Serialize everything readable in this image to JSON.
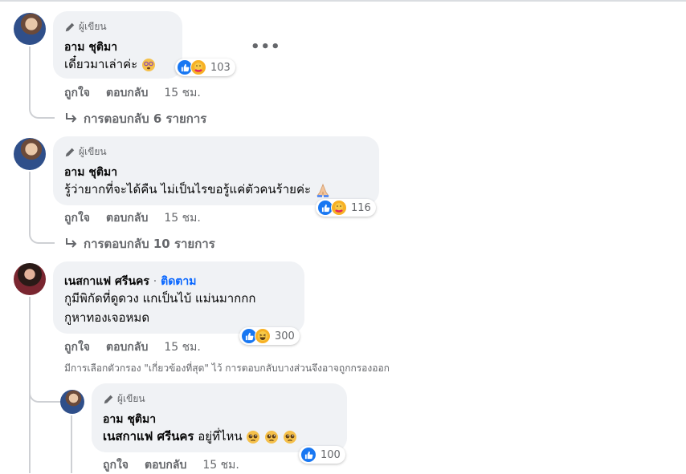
{
  "comments": [
    {
      "author_badge": "ผู้เขียน",
      "name": "อาม ชุติมา",
      "text": "เดี๋ยวมาเล่าค่ะ",
      "reaction_count": "103",
      "like_label": "ถูกใจ",
      "reply_label": "ตอบกลับ",
      "time": "15 ชม.",
      "replies_link": "การตอบกลับ 6 รายการ"
    },
    {
      "author_badge": "ผู้เขียน",
      "name": "อาม ชุติมา",
      "text": "รู้ว่ายากที่จะได้คืน ไม่เป็นไรขอรู้แค่ตัวคนร้ายค่ะ",
      "reaction_count": "116",
      "like_label": "ถูกใจ",
      "reply_label": "ตอบกลับ",
      "time": "15 ชม.",
      "replies_link": "การตอบกลับ 10 รายการ"
    },
    {
      "name": "เนสกาแฟ ศรีนคร",
      "follow_sep": "·",
      "follow_label": "ติดตาม",
      "text_line1": "กูมีพิกัดที่ดูดวง แกเป็นไบ้ แม่นมากกก",
      "text_line2": "กูหาทองเจอหมด",
      "reaction_count": "300",
      "like_label": "ถูกใจ",
      "reply_label": "ตอบกลับ",
      "time": "15 ชม.",
      "filter_note": "มีการเลือกตัวกรอง \"เกี่ยวข้องที่สุด\" ไว้ การตอบกลับบางส่วนจึงอาจถูกกรองออก"
    },
    {
      "author_badge": "ผู้เขียน",
      "name": "อาม ชุติมา",
      "mention": "เนสกาแฟ ศรีนคร",
      "text": "อยู่ที่ไหน",
      "reaction_count": "100",
      "like_label": "ถูกใจ",
      "reply_label": "ตอบกลับ",
      "time": "15 ชม."
    }
  ],
  "more_options": "•••",
  "colors": {
    "bubble": "#f0f2f5",
    "link_blue": "#0866ff",
    "secondary_text": "#65676b",
    "like_blue": "#1877f2"
  },
  "icons": [
    "pen-icon",
    "like-reaction-icon",
    "care-reaction-icon",
    "haha-reaction-icon",
    "reply-arrow-icon",
    "more-dots-icon",
    "pleading-face-emoji",
    "praying-hands-emoji",
    "dizzy-face-emoji"
  ]
}
